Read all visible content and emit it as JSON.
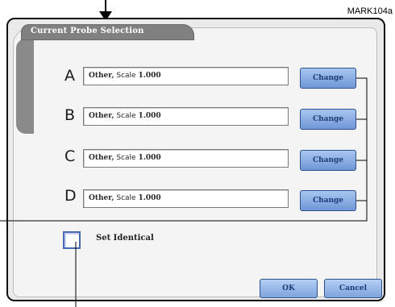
{
  "figure_label": "MARK104a",
  "dialog": {
    "section_title": "Current Probe Selection",
    "probes": [
      {
        "letter": "A",
        "type": "Other,",
        "scale_label": "Scale",
        "scale_value": "1.000",
        "button": "Change"
      },
      {
        "letter": "B",
        "type": "Other,",
        "scale_label": "Scale",
        "scale_value": "1.000",
        "button": "Change"
      },
      {
        "letter": "C",
        "type": "Other,",
        "scale_label": "Scale",
        "scale_value": "1.000",
        "button": "Change"
      },
      {
        "letter": "D",
        "type": "Other,",
        "scale_label": "Scale",
        "scale_value": "1.000",
        "button": "Change"
      }
    ],
    "set_identical_label": "Set Identical",
    "set_identical_checked": false,
    "ok_label": "OK",
    "cancel_label": "Cancel"
  },
  "icons": {
    "top_arrow": "down-arrow-icon"
  }
}
